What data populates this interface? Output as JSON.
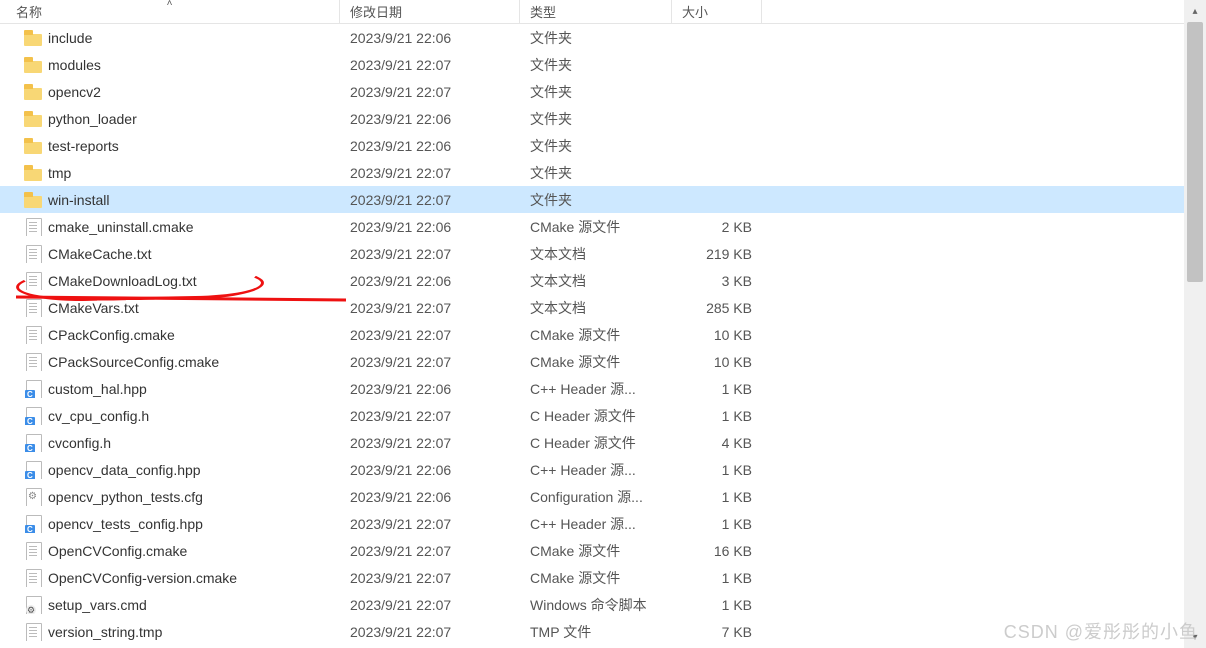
{
  "columns": {
    "name": "名称",
    "date": "修改日期",
    "type": "类型",
    "size": "大小"
  },
  "watermark": "CSDN @爱彤彤的小鱼",
  "selected_index": 6,
  "highlighted_index": 9,
  "files": [
    {
      "name": "include",
      "date": "2023/9/21 22:06",
      "type": "文件夹",
      "size": "",
      "icon": "folder"
    },
    {
      "name": "modules",
      "date": "2023/9/21 22:07",
      "type": "文件夹",
      "size": "",
      "icon": "folder"
    },
    {
      "name": "opencv2",
      "date": "2023/9/21 22:07",
      "type": "文件夹",
      "size": "",
      "icon": "folder"
    },
    {
      "name": "python_loader",
      "date": "2023/9/21 22:06",
      "type": "文件夹",
      "size": "",
      "icon": "folder"
    },
    {
      "name": "test-reports",
      "date": "2023/9/21 22:06",
      "type": "文件夹",
      "size": "",
      "icon": "folder"
    },
    {
      "name": "tmp",
      "date": "2023/9/21 22:07",
      "type": "文件夹",
      "size": "",
      "icon": "folder"
    },
    {
      "name": "win-install",
      "date": "2023/9/21 22:07",
      "type": "文件夹",
      "size": "",
      "icon": "folder"
    },
    {
      "name": "cmake_uninstall.cmake",
      "date": "2023/9/21 22:06",
      "type": "CMake 源文件",
      "size": "2 KB",
      "icon": "file"
    },
    {
      "name": "CMakeCache.txt",
      "date": "2023/9/21 22:07",
      "type": "文本文档",
      "size": "219 KB",
      "icon": "file"
    },
    {
      "name": "CMakeDownloadLog.txt",
      "date": "2023/9/21 22:06",
      "type": "文本文档",
      "size": "3 KB",
      "icon": "file"
    },
    {
      "name": "CMakeVars.txt",
      "date": "2023/9/21 22:07",
      "type": "文本文档",
      "size": "285 KB",
      "icon": "file"
    },
    {
      "name": "CPackConfig.cmake",
      "date": "2023/9/21 22:07",
      "type": "CMake 源文件",
      "size": "10 KB",
      "icon": "file"
    },
    {
      "name": "CPackSourceConfig.cmake",
      "date": "2023/9/21 22:07",
      "type": "CMake 源文件",
      "size": "10 KB",
      "icon": "file"
    },
    {
      "name": "custom_hal.hpp",
      "date": "2023/9/21 22:06",
      "type": "C++ Header 源...",
      "size": "1 KB",
      "icon": "code"
    },
    {
      "name": "cv_cpu_config.h",
      "date": "2023/9/21 22:07",
      "type": "C Header 源文件",
      "size": "1 KB",
      "icon": "code"
    },
    {
      "name": "cvconfig.h",
      "date": "2023/9/21 22:07",
      "type": "C Header 源文件",
      "size": "4 KB",
      "icon": "code"
    },
    {
      "name": "opencv_data_config.hpp",
      "date": "2023/9/21 22:06",
      "type": "C++ Header 源...",
      "size": "1 KB",
      "icon": "code"
    },
    {
      "name": "opencv_python_tests.cfg",
      "date": "2023/9/21 22:06",
      "type": "Configuration 源...",
      "size": "1 KB",
      "icon": "cfg"
    },
    {
      "name": "opencv_tests_config.hpp",
      "date": "2023/9/21 22:07",
      "type": "C++ Header 源...",
      "size": "1 KB",
      "icon": "code"
    },
    {
      "name": "OpenCVConfig.cmake",
      "date": "2023/9/21 22:07",
      "type": "CMake 源文件",
      "size": "16 KB",
      "icon": "file"
    },
    {
      "name": "OpenCVConfig-version.cmake",
      "date": "2023/9/21 22:07",
      "type": "CMake 源文件",
      "size": "1 KB",
      "icon": "file"
    },
    {
      "name": "setup_vars.cmd",
      "date": "2023/9/21 22:07",
      "type": "Windows 命令脚本",
      "size": "1 KB",
      "icon": "cmd"
    },
    {
      "name": "version_string.tmp",
      "date": "2023/9/21 22:07",
      "type": "TMP 文件",
      "size": "7 KB",
      "icon": "file"
    }
  ]
}
